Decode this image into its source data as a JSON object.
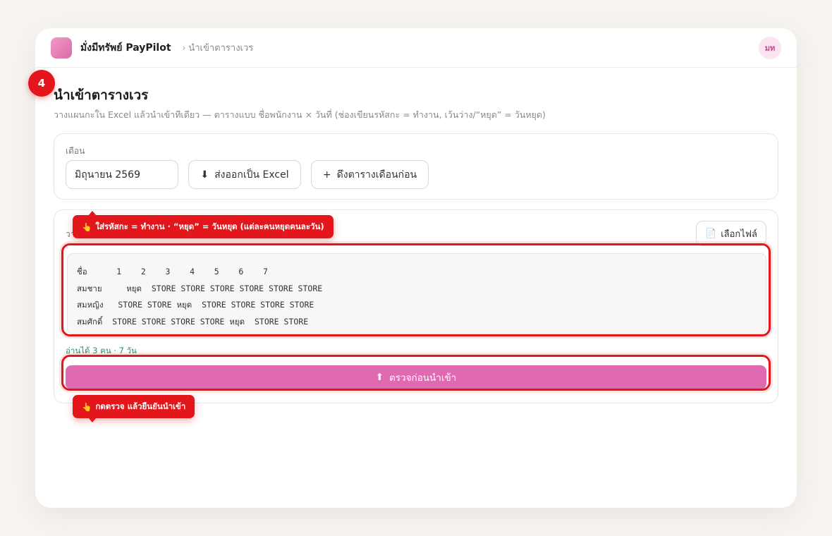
{
  "app": {
    "name": "มั่งมีทรัพย์ PayPilot",
    "breadcrumb": "นำเข้าตารางเวร",
    "avatar_initials": "มท"
  },
  "step": {
    "number": "4"
  },
  "page": {
    "title": "นำเข้าตารางเวร",
    "subtitle": "วางแผนกะใน Excel แล้วนำเข้าทีเดียว — ตารางแบบ ชื่อพนักงาน × วันที่ (ช่องเขียนรหัสกะ = ทำงาน, เว้นว่าง/“หยุด” = วันหยุด)"
  },
  "month_section": {
    "label": "เดือน",
    "value": "มิถุนายน 2569",
    "export_button": "ส่งออกเป็น Excel",
    "pull_button": "ดึงตารางเดือนก่อน"
  },
  "import_section": {
    "label": "วา",
    "file_button": "เลือกไฟล์",
    "grid_text": "ชื่อ      1    2    3    4    5    6    7\nสมชาย     หยุด  STORE STORE STORE STORE STORE STORE\nสมหญิง   STORE STORE หยุด  STORE STORE STORE STORE\nสมศักดิ์  STORE STORE STORE STORE หยุด  STORE STORE",
    "parsed_status": "อ่านได้ 3 คน · 7 วัน",
    "check_button": "ตรวจก่อนนำเข้า"
  },
  "tooltips": {
    "tip1": "ใส่รหัสกะ = ทำงาน · “หยุด” = วันหยุด (แต่ละคนหยุดคนละวัน)",
    "tip2": "กดตรวจ แล้วยืนยันนำเข้า"
  },
  "icons": {
    "export": "⬇",
    "pull": "+",
    "file": "📄",
    "check": "⬆",
    "pointer": "👆",
    "chevron": "›"
  },
  "colors": {
    "accent": "#e06aaf",
    "highlight": "#e3161b",
    "status_ok": "#2e8f6a"
  }
}
